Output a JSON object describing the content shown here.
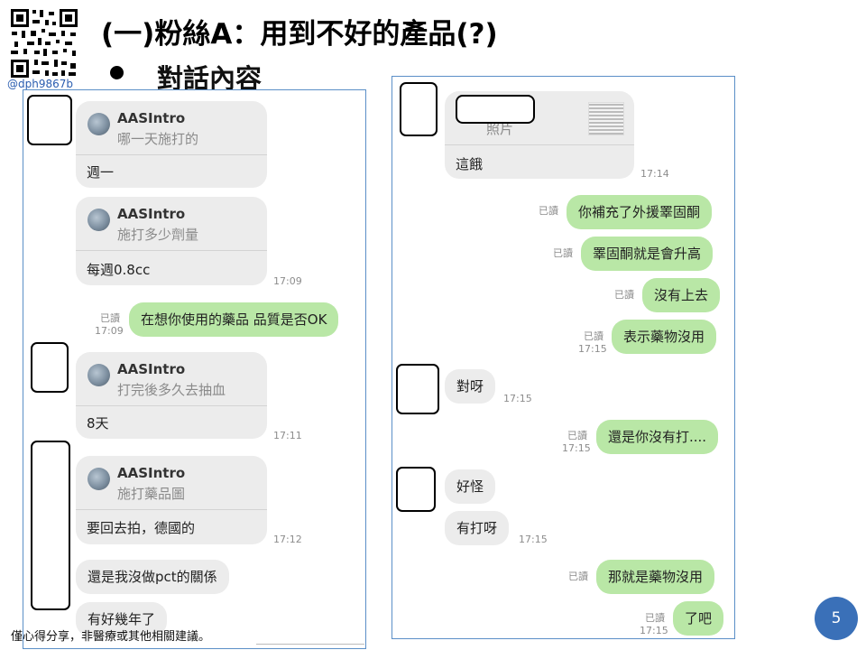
{
  "header": {
    "handle": "@dph9867b",
    "title": "(一)粉絲A：用到不好的產品(?)",
    "bullet": "對話內容"
  },
  "left_chat": {
    "cards": [
      {
        "name": "AASIntro",
        "question": "哪一天施打的",
        "answer": "週一",
        "time": ""
      },
      {
        "name": "AASIntro",
        "question": "施打多少劑量",
        "answer": "每週0.8cc",
        "time": "17:09"
      },
      {
        "name": "AASIntro",
        "question": "打完後多久去抽血",
        "answer": "8天",
        "time": "17:11"
      },
      {
        "name": "AASIntro",
        "question": "施打藥品圖",
        "answer": "要回去拍，德國的",
        "time": "17:12"
      }
    ],
    "outgoing": {
      "text": "在想你使用的藥品 品質是否OK",
      "read": "已讀",
      "time": "17:09"
    },
    "incoming": [
      "還是我沒做pct的關係",
      "有好幾年了"
    ]
  },
  "right_chat": {
    "photo_card": {
      "label": "照片",
      "answer": "這餓",
      "time": "17:14"
    },
    "messages": [
      {
        "dir": "out",
        "text": "你補充了外援睪固酮",
        "read": "已讀",
        "time": ""
      },
      {
        "dir": "out",
        "text": "睪固酮就是會升高",
        "read": "已讀",
        "time": ""
      },
      {
        "dir": "out",
        "text": "沒有上去",
        "read": "已讀",
        "time": ""
      },
      {
        "dir": "out",
        "text": "表示藥物沒用",
        "read": "已讀",
        "time": "17:15"
      },
      {
        "dir": "in",
        "text": "對呀",
        "time": "17:15"
      },
      {
        "dir": "out",
        "text": "還是你沒有打....",
        "read": "已讀",
        "time": "17:15"
      },
      {
        "dir": "in",
        "text": "好怪",
        "time": ""
      },
      {
        "dir": "in",
        "text": "有打呀",
        "time": "17:15"
      },
      {
        "dir": "out",
        "text": "那就是藥物沒用",
        "read": "已讀",
        "time": ""
      },
      {
        "dir": "out",
        "text": "了吧",
        "read": "已讀",
        "time": "17:15"
      }
    ]
  },
  "footer": {
    "disclaimer": "僅心得分享，非醫療或其他相關建議。",
    "page_number": "5"
  },
  "colors": {
    "outgoing_bubble": "#b9e7a6",
    "incoming_bubble": "#ececec",
    "panel_border": "#5b8fc7",
    "page_badge": "#3a70b8"
  }
}
